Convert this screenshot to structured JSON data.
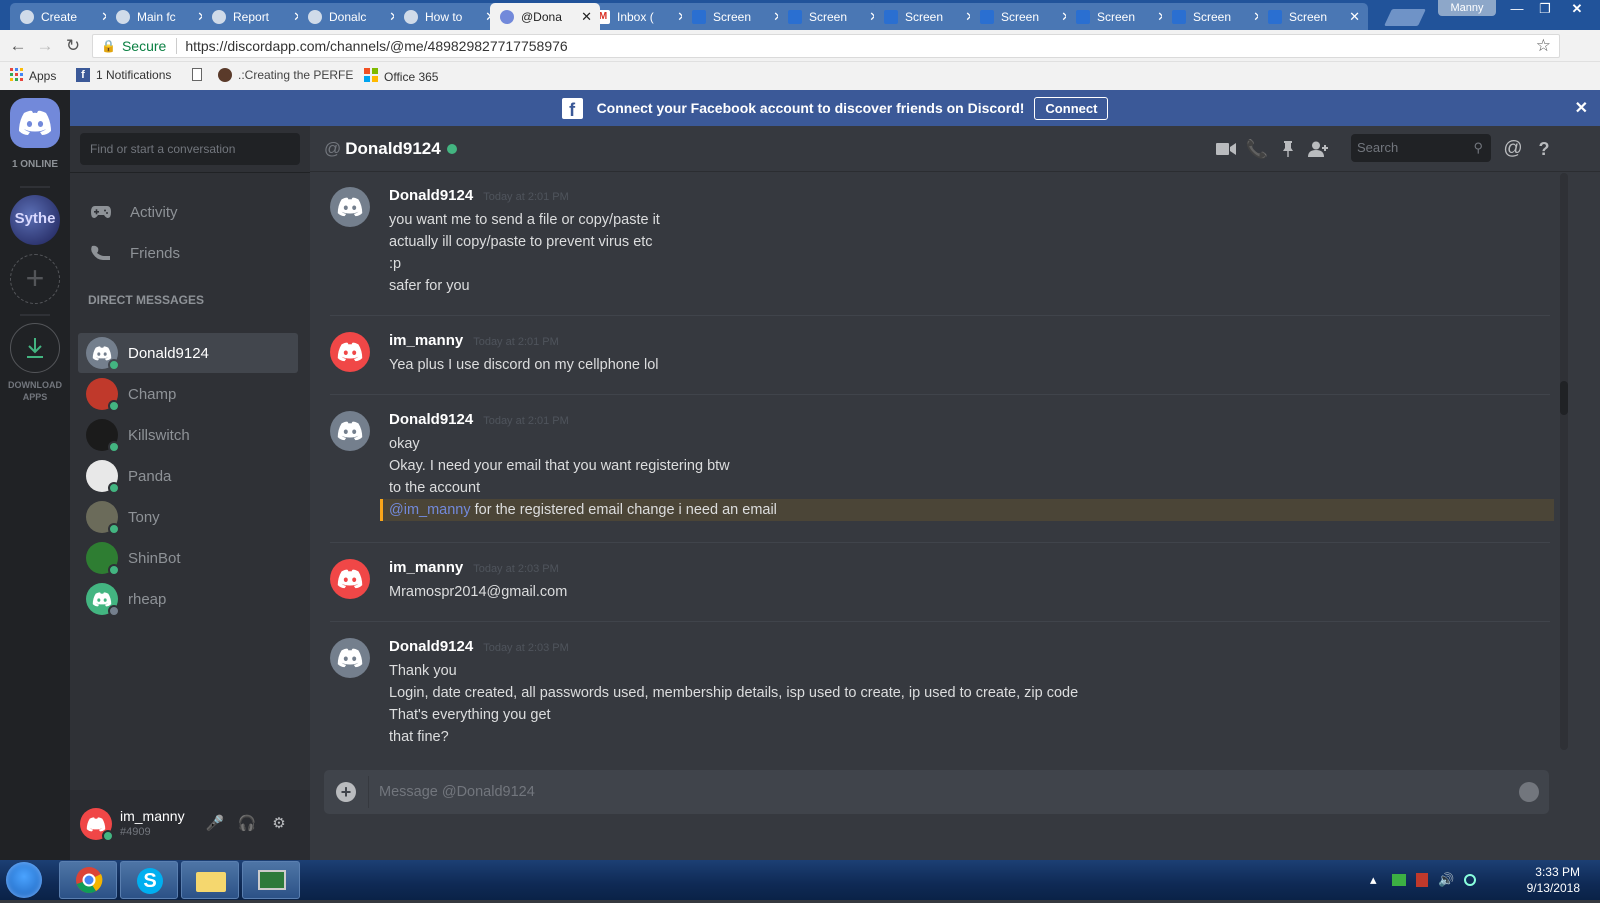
{
  "browser": {
    "tabs": [
      {
        "label": "Create",
        "icon": "shield"
      },
      {
        "label": "Main fc",
        "icon": "shield"
      },
      {
        "label": "Report",
        "icon": "shield"
      },
      {
        "label": "Donalc",
        "icon": "shield"
      },
      {
        "label": "How to",
        "icon": "shield"
      },
      {
        "label": "@Dona",
        "icon": "discord",
        "active": true
      },
      {
        "label": "Inbox (",
        "icon": "gmail"
      },
      {
        "label": "Screen",
        "icon": "screenshot"
      },
      {
        "label": "Screen",
        "icon": "screenshot"
      },
      {
        "label": "Screen",
        "icon": "screenshot"
      },
      {
        "label": "Screen",
        "icon": "screenshot"
      },
      {
        "label": "Screen",
        "icon": "screenshot"
      },
      {
        "label": "Screen",
        "icon": "screenshot"
      },
      {
        "label": "Screen",
        "icon": "screenshot"
      }
    ],
    "profile_name": "Manny",
    "secure_label": "Secure",
    "url": "https://discordapp.com/channels/@me/489829827717758976",
    "bookmarks": [
      {
        "label": "Apps",
        "icon": "apps-grid-icon"
      },
      {
        "label": "1 Notifications",
        "icon": "facebook-icon"
      },
      {
        "label": "",
        "icon": "page-icon"
      },
      {
        "label": ".:Creating the PERFE",
        "icon": "site-icon"
      },
      {
        "label": "Office 365",
        "icon": "office-icon"
      }
    ]
  },
  "discord": {
    "facebook_banner": {
      "text": "Connect your Facebook account to discover friends on Discord!",
      "button": "Connect"
    },
    "guilds": {
      "online_label": "1 ONLINE",
      "server_name": "Sythe",
      "download_label": "DOWNLOAD APPS"
    },
    "sidebar": {
      "search_placeholder": "Find or start a conversation",
      "activity": "Activity",
      "friends": "Friends",
      "dm_header": "DIRECT MESSAGES",
      "dms": [
        {
          "name": "Donald9124",
          "status": "online",
          "selected": true,
          "avatar_color": "#747f8d"
        },
        {
          "name": "Champ",
          "status": "online",
          "avatar_color": "#c0392b"
        },
        {
          "name": "Killswitch",
          "status": "online",
          "avatar_color": "#1b1b1b"
        },
        {
          "name": "Panda",
          "status": "online",
          "avatar_color": "#e8e8e8"
        },
        {
          "name": "Tony",
          "status": "online",
          "avatar_color": "#6b6b5a"
        },
        {
          "name": "ShinBot",
          "status": "online",
          "avatar_color": "#2e7d32"
        },
        {
          "name": "rheap",
          "status": "offline",
          "avatar_color": "#43b581"
        }
      ]
    },
    "user": {
      "name": "im_manny",
      "tag": "#4909"
    },
    "channel": {
      "name": "Donald9124",
      "search_placeholder": "Search"
    },
    "message_groups": [
      {
        "author": "Donald9124",
        "time": "Today at 2:01 PM",
        "avatar": "gray",
        "lines": [
          {
            "text": "you want me to send a file or copy/paste it"
          },
          {
            "text": "actually ill copy/paste to prevent virus etc"
          },
          {
            "text": ":p"
          },
          {
            "text": "safer for you"
          }
        ]
      },
      {
        "author": "im_manny",
        "time": "Today at 2:01 PM",
        "avatar": "red",
        "lines": [
          {
            "text": "Yea plus I use discord on my cellphone lol"
          }
        ]
      },
      {
        "author": "Donald9124",
        "time": "Today at 2:01 PM",
        "avatar": "gray",
        "lines": [
          {
            "text": "okay"
          },
          {
            "text": "Okay. I need your email that you want registering btw"
          },
          {
            "text": "to the account"
          },
          {
            "mention": "@im_manny",
            "text": " for the registered email change i need an email"
          }
        ]
      },
      {
        "author": "im_manny",
        "time": "Today at 2:03 PM",
        "avatar": "red",
        "lines": [
          {
            "text": "Mramospr2014@gmail.com"
          }
        ]
      },
      {
        "author": "Donald9124",
        "time": "Today at 2:03 PM",
        "avatar": "gray",
        "lines": [
          {
            "text": "Thank you"
          },
          {
            "text": "Login, date created, all passwords used, membership details, isp used to create, ip used to create, zip code"
          },
          {
            "text": "That's everything you get"
          },
          {
            "text": "that fine?"
          }
        ]
      }
    ],
    "composer_placeholder": "Message @Donald9124"
  },
  "taskbar": {
    "time": "3:33 PM",
    "date": "9/13/2018"
  }
}
